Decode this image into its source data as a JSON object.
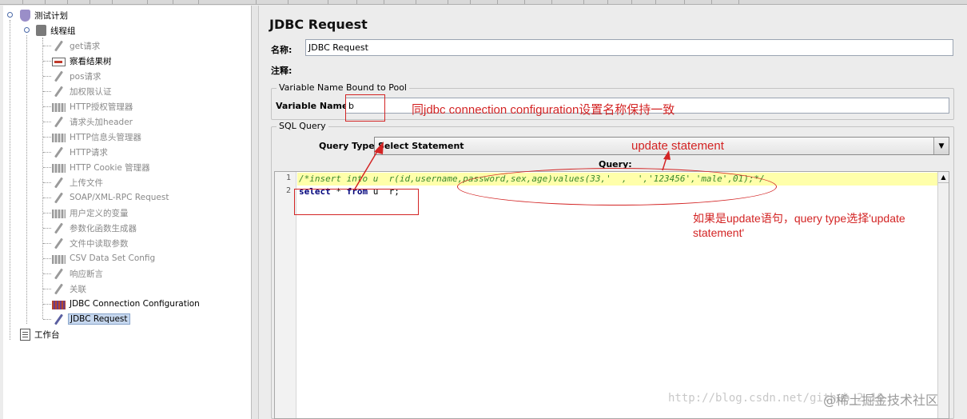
{
  "tree": {
    "plan": "测试计划",
    "group": "线程组",
    "items": [
      {
        "label": "get请求",
        "icon": "sampler-icon",
        "dim": true
      },
      {
        "label": "察看结果树",
        "icon": "result-tree-icon",
        "dim": false
      },
      {
        "label": "pos请求",
        "icon": "sampler-icon",
        "dim": true
      },
      {
        "label": "加权限认证",
        "icon": "sampler-icon",
        "dim": true
      },
      {
        "label": "HTTP授权管理器",
        "icon": "config-icon",
        "dim": true
      },
      {
        "label": "请求头加header",
        "icon": "sampler-icon",
        "dim": true
      },
      {
        "label": "HTTP信息头管理器",
        "icon": "config-icon",
        "dim": true
      },
      {
        "label": "HTTP请求",
        "icon": "sampler-icon",
        "dim": true
      },
      {
        "label": "HTTP Cookie 管理器",
        "icon": "config-icon",
        "dim": true
      },
      {
        "label": "上传文件",
        "icon": "sampler-icon",
        "dim": true
      },
      {
        "label": "SOAP/XML-RPC Request",
        "icon": "sampler-icon",
        "dim": true
      },
      {
        "label": "用户定义的变量",
        "icon": "config-icon",
        "dim": true
      },
      {
        "label": "参数化函数生成器",
        "icon": "sampler-icon",
        "dim": true
      },
      {
        "label": "文件中读取参数",
        "icon": "sampler-icon",
        "dim": true
      },
      {
        "label": "CSV Data Set Config",
        "icon": "config-icon",
        "dim": true
      },
      {
        "label": "响应断言",
        "icon": "sampler-icon",
        "dim": true
      },
      {
        "label": "关联",
        "icon": "sampler-icon",
        "dim": true
      },
      {
        "label": "JDBC Connection Configuration",
        "icon": "config-icon",
        "dim": false
      },
      {
        "label": "JDBC Request",
        "icon": "sampler-icon",
        "dim": false,
        "selected": true
      }
    ],
    "workbench": "工作台"
  },
  "panel": {
    "title": "JDBC Request",
    "name_label": "名称:",
    "name_value": "JDBC Request",
    "comment_label": "注释:",
    "comment_value": "",
    "pool_group": "Variable Name Bound to Pool",
    "var_label": "Variable Name:",
    "var_value": "b",
    "sql_group": "SQL Query",
    "qtype_label": "Query Type:",
    "qtype_value": "Select Statement",
    "query_label": "Query:",
    "lines": [
      {
        "num": "1",
        "text": "/*insert into u  r(id,username,password,sex,age)values(33,'  ,  ','123456','male',01);*/"
      },
      {
        "num": "2",
        "kw1": "select",
        "mid": " * ",
        "kw2": "from",
        "rest": " u  r;"
      }
    ]
  },
  "annotations": {
    "var_note": "同jdbc connection configuration设置名称保持一致",
    "update_note": "update statement",
    "hint_line1": "如果是update语句，query type选择'update",
    "hint_line2": "statement'"
  },
  "watermark": {
    "url": "http://blog.csdn.net/github_2  10",
    "site": "@稀土掘金技术社区"
  },
  "colors": {
    "annotation": "#d32424",
    "highlight_line": "#ffffaa",
    "selection": "#c6d7ee"
  }
}
